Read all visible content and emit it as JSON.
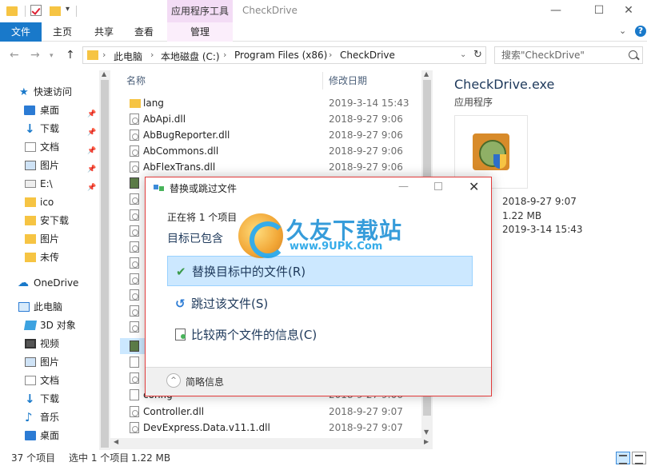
{
  "window": {
    "title": "CheckDrive",
    "contextual_tab_title": "应用程序工具",
    "minimize": "—",
    "maximize": "☐",
    "close": "✕"
  },
  "ribbon": {
    "tabs": [
      {
        "label": "文件",
        "active": true
      },
      {
        "label": "主页"
      },
      {
        "label": "共享"
      },
      {
        "label": "查看"
      },
      {
        "label": "管理"
      }
    ],
    "collapse": "⌄",
    "help": "?"
  },
  "address": {
    "crumbs": [
      "此电脑",
      "本地磁盘 (C:)",
      "Program Files (x86)",
      "CheckDrive"
    ],
    "separator": "›"
  },
  "search": {
    "placeholder": "搜索\"CheckDrive\""
  },
  "nav": {
    "items": [
      {
        "label": "快速访问",
        "icon": "star-icon",
        "pinned": false
      },
      {
        "label": "桌面",
        "icon": "desktop-icon",
        "pinned": true
      },
      {
        "label": "下载",
        "icon": "download-arrow-icon",
        "pinned": true
      },
      {
        "label": "文档",
        "icon": "document-icon",
        "pinned": true
      },
      {
        "label": "图片",
        "icon": "picture-icon",
        "pinned": true
      },
      {
        "label": "E:\\",
        "icon": "drive-icon",
        "pinned": true
      },
      {
        "label": "ico",
        "icon": "folder-icon",
        "pinned": false
      },
      {
        "label": "安下载",
        "icon": "folder-icon",
        "pinned": false
      },
      {
        "label": "图片",
        "icon": "folder-icon",
        "pinned": false
      },
      {
        "label": "未传",
        "icon": "folder-icon",
        "pinned": false
      },
      {
        "label": "OneDrive",
        "icon": "cloud-icon",
        "pinned": false
      },
      {
        "label": "此电脑",
        "icon": "pc-icon",
        "pinned": false
      },
      {
        "label": "3D 对象",
        "icon": "3d-objects-icon",
        "pinned": false
      },
      {
        "label": "视频",
        "icon": "video-icon",
        "pinned": false
      },
      {
        "label": "图片",
        "icon": "picture-icon",
        "pinned": false
      },
      {
        "label": "文档",
        "icon": "document-icon",
        "pinned": false
      },
      {
        "label": "下载",
        "icon": "download-arrow-icon",
        "pinned": false
      },
      {
        "label": "音乐",
        "icon": "music-icon",
        "pinned": false
      },
      {
        "label": "桌面",
        "icon": "desktop-icon",
        "pinned": false
      }
    ]
  },
  "filelist": {
    "headers": {
      "name": "名称",
      "date": "修改日期"
    },
    "rows": [
      {
        "name": "lang",
        "date": "2019-3-14 15:43",
        "type": "folder"
      },
      {
        "name": "AbApi.dll",
        "date": "2018-9-27 9:06",
        "type": "dll"
      },
      {
        "name": "AbBugReporter.dll",
        "date": "2018-9-27 9:06",
        "type": "dll"
      },
      {
        "name": "AbCommons.dll",
        "date": "2018-9-27 9:06",
        "type": "dll"
      },
      {
        "name": "AbFlexTrans.dll",
        "date": "2018-9-27 9:06",
        "type": "dll"
      },
      {
        "name": "config",
        "date": "2018-9-27 9:06",
        "type": "plain"
      },
      {
        "name": "Controller.dll",
        "date": "2018-9-27 9:07",
        "type": "dll"
      },
      {
        "name": "DevExpress.Data.v11.1.dll",
        "date": "2018-9-27 9:07",
        "type": "dll"
      }
    ]
  },
  "preview": {
    "title": "CheckDrive.exe",
    "type": "应用程序",
    "modified": "2018-9-27 9:07",
    "size": "1.22 MB",
    "created": "2019-3-14 15:43"
  },
  "statusbar": {
    "count": "37 个项目",
    "selected": "选中 1 个项目",
    "size": "1.22 MB"
  },
  "dialog": {
    "title": "替换或跳过文件",
    "progress": "正在将 1 个项目",
    "contains": "目标已包含",
    "options": [
      {
        "label": "替换目标中的文件(R)",
        "icon": "checkmark-icon",
        "selected": true
      },
      {
        "label": "跳过该文件(S)",
        "icon": "skip-arrow-icon",
        "selected": false
      },
      {
        "label": "比较两个文件的信息(C)",
        "icon": "compare-icon",
        "selected": false
      }
    ],
    "brief": "简略信息"
  },
  "watermark": {
    "main": "久友下载站",
    "url": "www.9UPK.Com"
  },
  "colors": {
    "accent": "#1979ca",
    "selection": "#cce8ff",
    "dialog_border": "#e23b3b"
  }
}
